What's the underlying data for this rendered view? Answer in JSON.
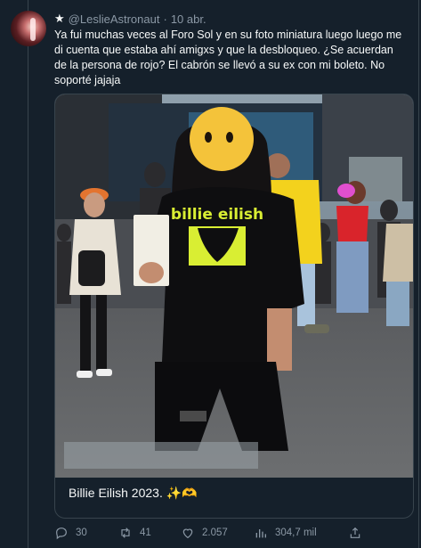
{
  "tweet": {
    "handle": "@LeslieAstronaut",
    "separator": "·",
    "date": "10 abr.",
    "text": "Ya fui muchas veces al Foro Sol y en su foto miniatura luego luego me di cuenta que estaba ahí amigxs y que la desbloqueo. ¿Se acuerdan de la persona de rojo? El cabrón se llevó a su ex con mi boleto. No soporté jajaja"
  },
  "card": {
    "caption": "Billie Eilish 2023.",
    "caption_emoji": "✨🫶",
    "shirt_text": "billie eilish"
  },
  "actions": {
    "replies": "30",
    "retweets": "41",
    "likes": "2.057",
    "views": "304,7 mil"
  },
  "icons": {
    "star": "star-icon",
    "reply": "reply-icon",
    "retweet": "retweet-icon",
    "like": "like-icon",
    "views": "views-icon",
    "share": "share-icon"
  }
}
